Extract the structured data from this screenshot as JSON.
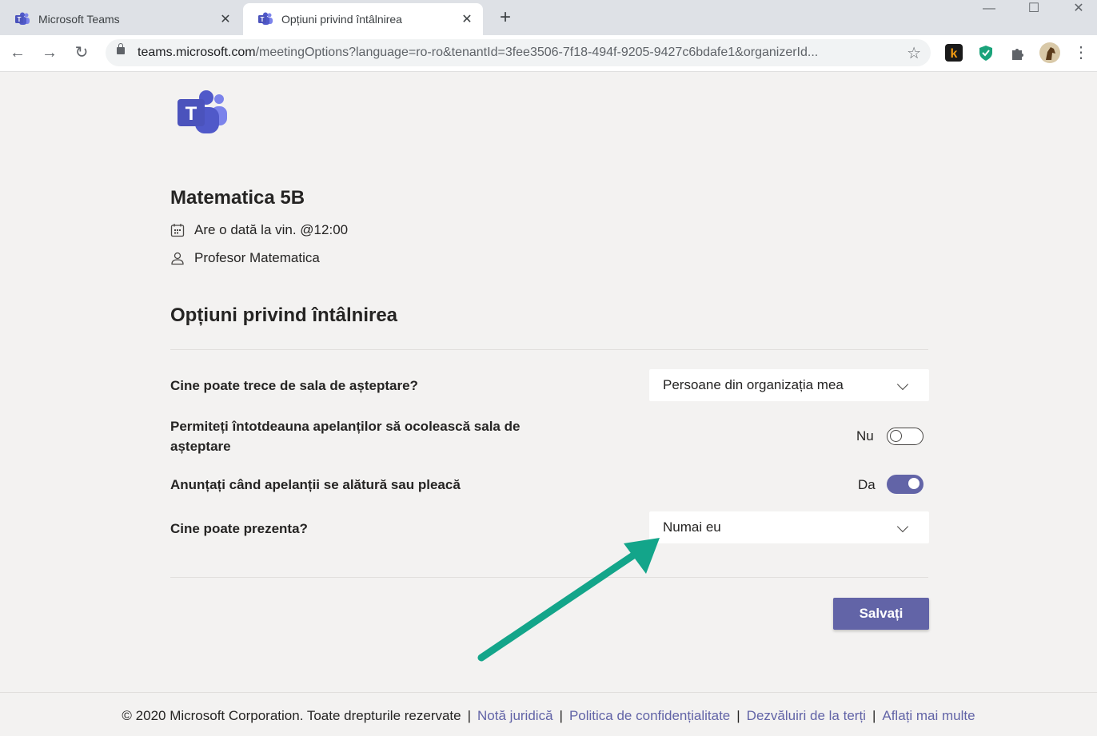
{
  "browser": {
    "tabs": [
      {
        "title": "Microsoft Teams",
        "active": false
      },
      {
        "title": "Opțiuni privind întâlnirea",
        "active": true
      }
    ],
    "url_host": "teams.microsoft.com",
    "url_path": "/meetingOptions?language=ro-ro&tenantId=3fee3506-7f18-494f-9205-9427c6bdafe1&organizerId..."
  },
  "meeting": {
    "title": "Matematica 5B",
    "schedule": "Are o dată la vin. @12:00",
    "organizer": "Profesor Matematica"
  },
  "options": {
    "section_title": "Opțiuni privind întâlnirea",
    "lobby_bypass": {
      "label": "Cine poate trece de sala de așteptare?",
      "value": "Persoane din organizația mea"
    },
    "dialin_bypass": {
      "label": "Permiteți întotdeauna apelanților să ocolească sala de așteptare",
      "state_text": "Nu",
      "on": false
    },
    "announce": {
      "label": "Anunțați când apelanții se alătură sau pleacă",
      "state_text": "Da",
      "on": true
    },
    "presenters": {
      "label": "Cine poate prezenta?",
      "value": "Numai eu"
    },
    "save_label": "Salvați"
  },
  "footer": {
    "copyright": "© 2020 Microsoft Corporation. Toate drepturile rezervate",
    "links": [
      "Notă juridică",
      "Politica de confidențialitate",
      "Dezvăluiri de la terți",
      "Aflați mai multe"
    ]
  },
  "colors": {
    "accent": "#6264a7",
    "annotation_arrow": "#13a58a",
    "page_bg": "#f3f2f1"
  }
}
